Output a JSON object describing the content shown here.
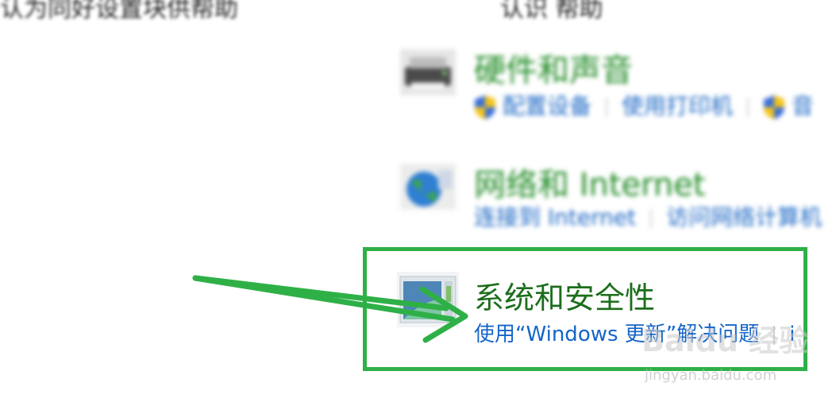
{
  "header": {
    "left_text": "认为同好设置块供帮助",
    "right_text": "认识     帮助"
  },
  "categories": [
    {
      "title": "硬件和声音",
      "links": [
        "配置设备",
        "使用打印机",
        "音"
      ]
    },
    {
      "title": "网络和 Internet",
      "links": [
        "连接到 Internet",
        "访问网络计算机"
      ]
    },
    {
      "title": "系统和安全性",
      "links": [
        "使用“Windows 更新”解决问题",
        "i"
      ]
    }
  ],
  "watermark": {
    "main": "Baidu 经验",
    "sub": "jingyan.baidu.com"
  },
  "colors": {
    "highlight": "#2eb047",
    "arrow": "#2eb047",
    "title_green": "#1c6e1c",
    "link_blue": "#1565c8"
  }
}
